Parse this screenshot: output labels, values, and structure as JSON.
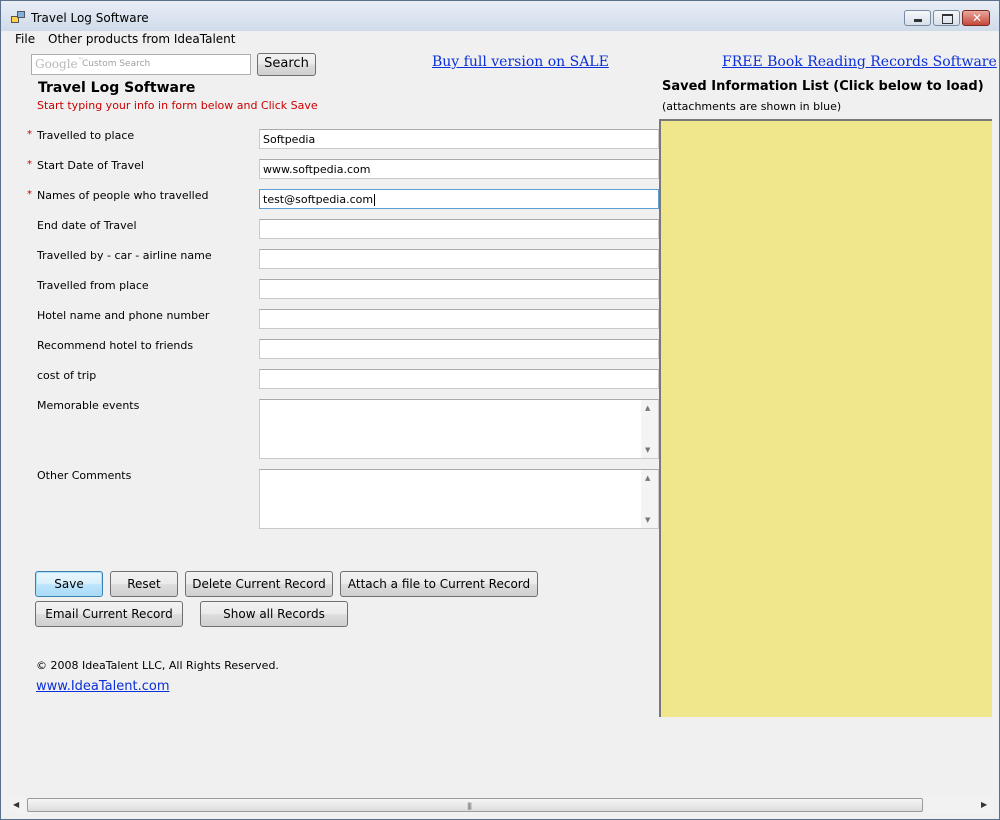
{
  "window": {
    "title": "Travel Log Software"
  },
  "menu": {
    "items": [
      "File",
      "Other products from IdeaTalent"
    ]
  },
  "search": {
    "logo": "Google",
    "placeholder": "Custom Search",
    "button": "Search"
  },
  "links": {
    "buy": "Buy full version on SALE",
    "free_book": "FREE Book Reading Records Software",
    "website": "www.IdeaTalent.com"
  },
  "form": {
    "title": "Travel Log Software",
    "instruction": "Start typing your info in form below and Click Save",
    "fields": [
      {
        "label": "Travelled to place",
        "value": "Softpedia",
        "required": true
      },
      {
        "label": "Start Date of Travel",
        "value": "www.softpedia.com",
        "required": true
      },
      {
        "label": "Names of people who travelled",
        "value": "test@softpedia.com",
        "required": true
      },
      {
        "label": "End date of Travel",
        "value": "",
        "required": false
      },
      {
        "label": "Travelled by - car - airline name",
        "value": "",
        "required": false
      },
      {
        "label": "Travelled from place",
        "value": "",
        "required": false
      },
      {
        "label": "Hotel name and phone number",
        "value": "",
        "required": false
      },
      {
        "label": "Recommend hotel to friends",
        "value": "",
        "required": false
      },
      {
        "label": "cost of trip",
        "value": "",
        "required": false
      }
    ],
    "memorable_label": "Memorable events",
    "comments_label": "Other Comments",
    "required_mark": "*"
  },
  "buttons": {
    "save": "Save",
    "reset": "Reset",
    "delete": "Delete Current Record",
    "attach": "Attach a file to Current Record",
    "email": "Email Current Record",
    "show_all": "Show all Records"
  },
  "saved_list": {
    "title": "Saved Information List (Click below to load)",
    "note": "(attachments are shown in blue)",
    "background": "#f0e68c"
  },
  "footer": {
    "copyright": "© 2008 IdeaTalent LLC, All Rights Reserved."
  }
}
